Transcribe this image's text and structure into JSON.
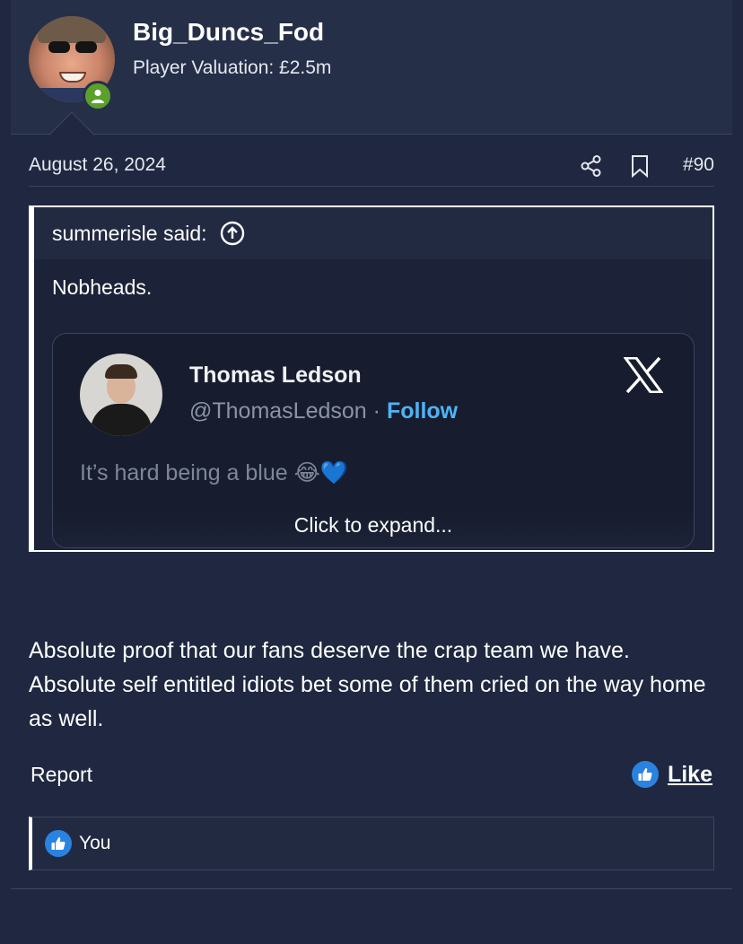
{
  "user": {
    "name": "Big_Duncs_Fod",
    "title": "Player Valuation: £2.5m"
  },
  "post": {
    "date": "August 26, 2024",
    "number": "#90",
    "body": "Absolute proof that our fans deserve the crap team we have. Absolute self entitled idiots bet some of them cried on the way home as well."
  },
  "quote": {
    "author_said": "summerisle said:",
    "text": "Nobheads.",
    "expand_label": "Click to expand..."
  },
  "tweet": {
    "name": "Thomas Ledson",
    "handle": "@ThomasLedson",
    "separator": "·",
    "follow_label": "Follow",
    "text": "It’s hard being a blue 😂💙"
  },
  "actions": {
    "report_label": "Report",
    "like_label": "Like"
  },
  "reactions": {
    "label": "You"
  },
  "colors": {
    "background": "#1f2840",
    "header": "#262f48",
    "accent": "#4fb3f5",
    "like": "#2a83e0",
    "online": "#5aa02a"
  }
}
